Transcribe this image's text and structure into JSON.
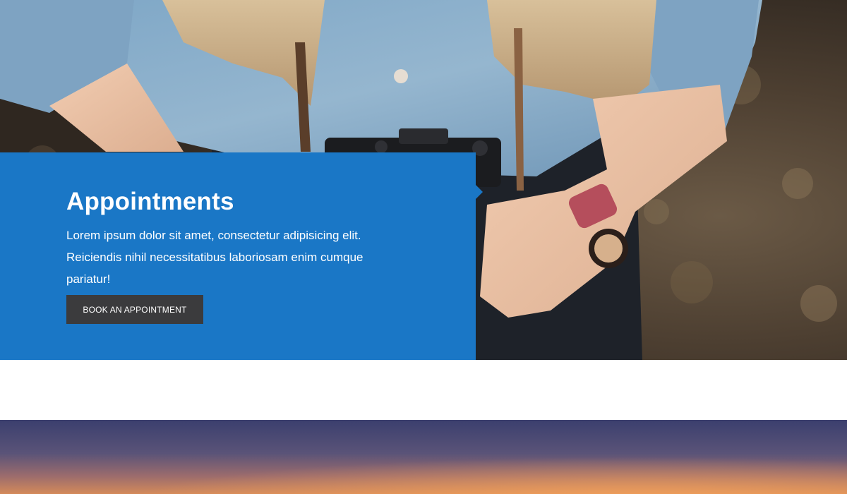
{
  "appointments": {
    "title": "Appointments",
    "description": "Lorem ipsum dolor sit amet, consectetur adipisicing elit. Reiciendis nihil necessitatibus laboriosam enim cumque pariatur!",
    "button_label": "BOOK AN APPOINTMENT"
  },
  "colors": {
    "panel_blue": "#1a77c6",
    "button_dark": "#3b3b3d",
    "text_white": "#ffffff"
  },
  "images": {
    "hero": "photo-woman-with-camera",
    "strip": "photo-sunset-sky"
  }
}
